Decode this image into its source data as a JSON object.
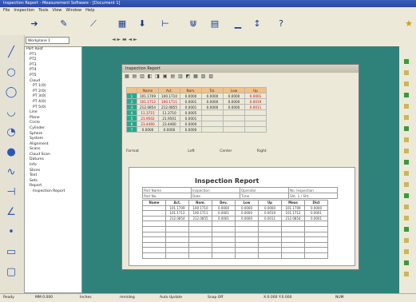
{
  "app": {
    "title": "Inspection Report - Measurement Software - [Document 1]"
  },
  "menu": [
    "File",
    "Inspection",
    "Tools",
    "View",
    "Window",
    "Help"
  ],
  "toolbar_icons": [
    "arrow-icon",
    "pencil-icon",
    "plane-icon",
    "table-icon",
    "probe-icon",
    "axis-icon",
    "scan-icon",
    "report-icon",
    "chart-icon",
    "move-icon",
    "help-icon"
  ],
  "toolbar2": {
    "field_value": "Workplane 1",
    "nav": "◄ ► ▬ ◄ ►"
  },
  "left_tools": [
    "line-icon",
    "circle-icon",
    "ellipse-icon",
    "cylinder-icon",
    "cone-icon",
    "sphere-icon",
    "curve-icon",
    "distance-icon",
    "angle-icon",
    "point-icon",
    "slot-icon",
    "rectangle-icon"
  ],
  "tree": [
    "Part Root",
    "PT1",
    "PT2",
    "PT3",
    "PT4",
    "PT5",
    "Cloud",
    "PT 1(0)",
    "PT 2(0)",
    "PT 3(0)",
    "PT 4(0)",
    "PT 5(0)",
    "Line",
    "Plane",
    "Circle",
    "Cylinder",
    "Sphere",
    "System",
    "Alignment",
    "Scans",
    "Cloud Scan",
    "Datums",
    "Info",
    "Slices",
    "Text",
    "Sets",
    "Report",
    "Inspection Report"
  ],
  "window": {
    "title": "Inspection Report",
    "toolbar_glyphs": "▦ ▤ ▥ ◧ ◨ ▣ ▤ ▥ ◩ ▦ ▧ ▨"
  },
  "grid": {
    "headers": [
      "Name",
      "Act.",
      "Nom.",
      "Tol.",
      "Low",
      "Up"
    ],
    "rows": [
      {
        "id": "1",
        "cells": [
          "101.1709",
          "100.1710",
          "0.0000",
          "0.0000",
          "0.0000",
          "0.0001"
        ],
        "red": [
          false,
          false,
          false,
          false,
          false,
          true
        ]
      },
      {
        "id": "2",
        "cells": [
          "101.1712",
          "100.1711",
          "0.0001",
          "0.0000",
          "0.0000",
          "0.0019"
        ],
        "red": [
          true,
          true,
          false,
          false,
          false,
          true
        ]
      },
      {
        "id": "3",
        "cells": [
          "212.0854",
          "212.0855",
          "0.0001",
          "0.0000",
          "0.0000",
          "0.0011"
        ],
        "red": [
          false,
          false,
          false,
          false,
          false,
          true
        ]
      },
      {
        "id": "4",
        "cells": [
          "11.3715",
          "11.3710",
          "0.0005",
          "",
          "",
          ""
        ],
        "red": [
          true,
          false,
          false,
          false,
          false,
          false
        ]
      },
      {
        "id": "5",
        "cells": [
          "21.9502",
          "21.9501",
          "0.0001",
          "",
          "",
          ""
        ],
        "red": [
          true,
          false,
          false,
          false,
          false,
          false
        ]
      },
      {
        "id": "6",
        "cells": [
          "23.4460",
          "23.4460",
          "0.0000",
          "",
          "",
          ""
        ],
        "red": [
          true,
          false,
          false,
          false,
          false,
          false
        ]
      },
      {
        "id": "7",
        "cells": [
          "0.0000",
          "0.0000",
          "0.0000",
          "",
          "",
          ""
        ],
        "red": [
          false,
          false,
          false,
          false,
          false,
          false
        ]
      }
    ]
  },
  "midbar": {
    "left": "Format",
    "f1": "Left",
    "f2": "Center",
    "f3": "Right"
  },
  "report": {
    "title": "Inspection Report",
    "info": [
      [
        "Part Name",
        "Inspection",
        "Operator",
        "No. Inspection"
      ],
      [
        "Part No.",
        "Date",
        "Time",
        "Sht. 1 / Sht"
      ]
    ],
    "headers": [
      "Name",
      "Act.",
      "Nom.",
      "Dev.",
      "Low",
      "Up",
      "Meas",
      "Dist"
    ],
    "rows": [
      [
        "",
        "101.1709",
        "100.1710",
        "0.0000",
        "0.0000",
        "0.0000",
        "101.1709",
        "0.0000"
      ],
      [
        "",
        "101.1712",
        "100.1711",
        "0.0001",
        "0.0000",
        "0.0019",
        "101.1712",
        "0.0001"
      ],
      [
        "",
        "212.0854",
        "212.0855",
        "0.0001",
        "0.0000",
        "0.0011",
        "212.0854",
        "0.0001"
      ],
      [
        "",
        "",
        "",
        "",
        "",
        "",
        "",
        ""
      ],
      [
        "",
        "",
        "",
        "",
        "",
        "",
        "",
        ""
      ],
      [
        "",
        "",
        "",
        "",
        "",
        "",
        "",
        ""
      ],
      [
        "",
        "",
        "",
        "",
        "",
        "",
        "",
        ""
      ],
      [
        "",
        "",
        "",
        "",
        "",
        "",
        "",
        ""
      ],
      [
        "",
        "",
        "",
        "",
        "",
        "",
        "",
        ""
      ],
      [
        "",
        "",
        "",
        "",
        "",
        "",
        "",
        ""
      ]
    ]
  },
  "status": [
    "Ready",
    "MM 0.000",
    "Inches",
    "mm/deg",
    "Auto Update",
    "Snap Off",
    "X:0.000 Y:0.000",
    "NUM"
  ]
}
